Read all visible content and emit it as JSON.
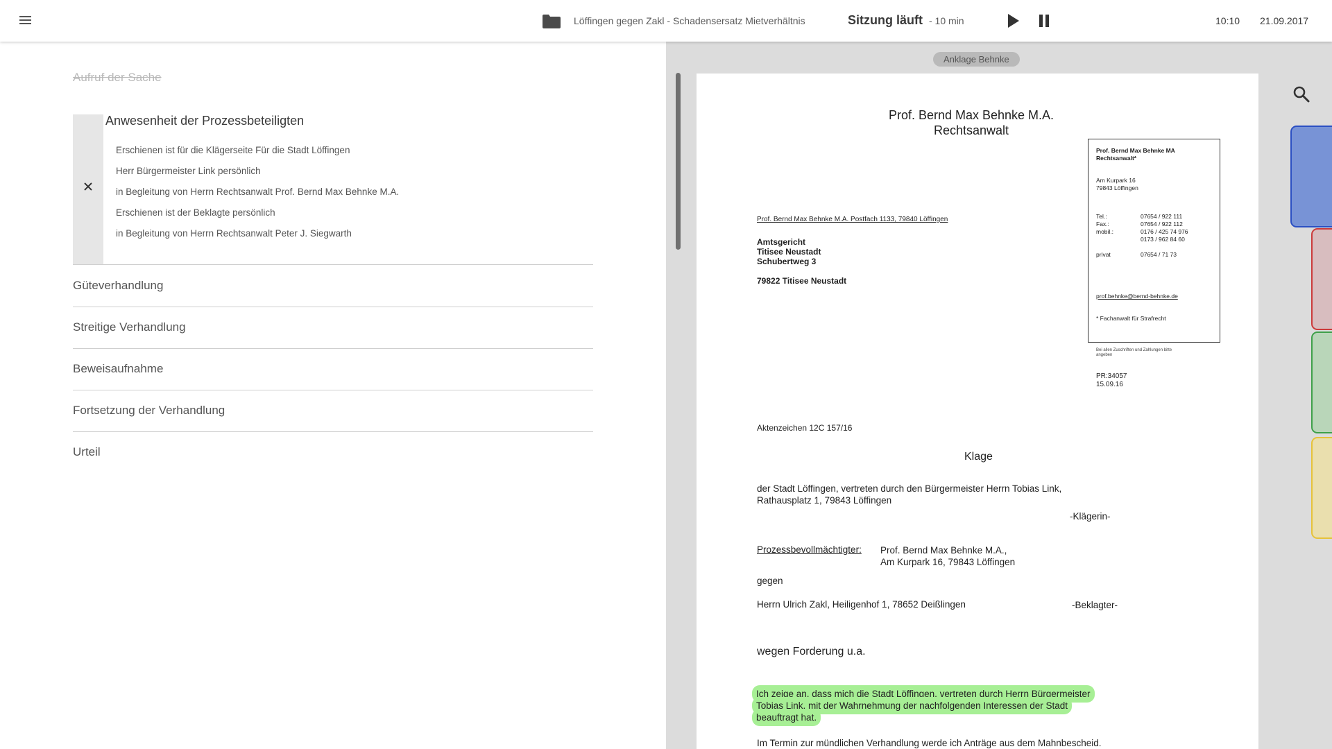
{
  "topbar": {
    "case_title": "Löffingen gegen Zakl - Schadensersatz Mietverhältnis",
    "session_status": "Sitzung läuft",
    "session_elapsed": "- 10 min",
    "time": "10:10",
    "date": "21.09.2017",
    "icons": {
      "menu": "menu-icon",
      "folder": "folder-icon",
      "play": "play-icon",
      "pause": "pause-icon"
    }
  },
  "agenda": {
    "completed_item": "Aufruf der Sache",
    "active_section": {
      "title": "Anwesenheit der Prozessbeteiligten",
      "entries": [
        "Erschienen ist für die Klägerseite Für die Stadt Löffingen",
        "Herr Bürgermeister Link persönlich",
        "in Begleitung von Herrn Rechtsanwalt Prof. Bernd Max Behnke M.A.",
        "Erschienen ist der Beklagte persönlich",
        "in Begleitung von Herrn Rechtsanwalt Peter J. Siegwarth"
      ]
    },
    "items": [
      "Güteverhandlung",
      "Streitige Verhandlung",
      "Beweisaufnahme",
      "Fortsetzung der Verhandlung",
      "Urteil"
    ]
  },
  "viewer": {
    "document_chip": "Anklage Behnke",
    "tab_colors": {
      "blue": "#7893d6",
      "red": "#d8bdbf",
      "green": "#b9d6b9",
      "yellow": "#eadfae"
    },
    "highlight_color": "#a7ef95",
    "letter": {
      "letterhead_name": "Prof. Bernd Max Behnke M.A.",
      "letterhead_title": "Rechtsanwalt",
      "sender_box": {
        "name": "Prof. Bernd Max Behnke MA",
        "title": "Rechtsanwalt*",
        "street": "Am Kurpark 16",
        "city": "79843 Löffingen",
        "tel_label": "Tel.:",
        "tel": "07654 / 922 111",
        "fax_label": "Fax.:",
        "fax": "07654 / 922 112",
        "mobil_label": "mobil.:",
        "mobil_1": "0176 / 425 74 976",
        "mobil_2": "0173 / 962 84 60",
        "privat_label": "privat",
        "privat": "07654 / 71 73",
        "email": "prof.behnke@bernd-behnke.de",
        "footnote": "* Fachanwalt für Strafrecht"
      },
      "note_small": "Bei allen Zuschriften und Zahlungen bitte angeben",
      "ref_pr": "PR:34057",
      "ref_date": "15.09.16",
      "return_address": "Prof. Bernd Max Behnke M.A. Postfach 1133, 79840 Löffingen",
      "recipient_1": "Amtsgericht",
      "recipient_2": "Titisee Neustadt",
      "recipient_3": "Schubertweg 3",
      "recipient_4": "79822 Titisee Neustadt",
      "aktenzeichen": "Aktenzeichen 12C 157/16",
      "heading": "Klage",
      "plaintiff_line_1": "der Stadt Löffingen, vertreten durch den Bürgermeister Herrn Tobias Link,",
      "plaintiff_line_2": "Rathausplatz 1, 79843 Löffingen",
      "plaintiff_role": "-Klägerin-",
      "counsel_label": "Prozessbevollmächtigter:",
      "counsel_line_1": "Prof. Bernd Max Behnke M.A.,",
      "counsel_line_2": "Am Kurpark 16, 79843 Löffingen",
      "against": "gegen",
      "defendant": "Herrn Ulrich Zakl, Heiligenhof 1, 78652 Deißlingen",
      "defendant_role": "-Beklagter-",
      "subject": "wegen Forderung u.a.",
      "highlight_line_1": "Ich zeige an, dass mich die Stadt Löffingen, vertreten durch Herrn Bürgermeister",
      "highlight_line_2": "Tobias Link, mit der Wahrnehmung der nachfolgenden Interessen der Stadt",
      "highlight_line_3": "beauftragt hat.",
      "last_line": "Im Termin zur mündlichen Verhandlung werde ich Anträge aus dem Mahnbescheid."
    }
  }
}
